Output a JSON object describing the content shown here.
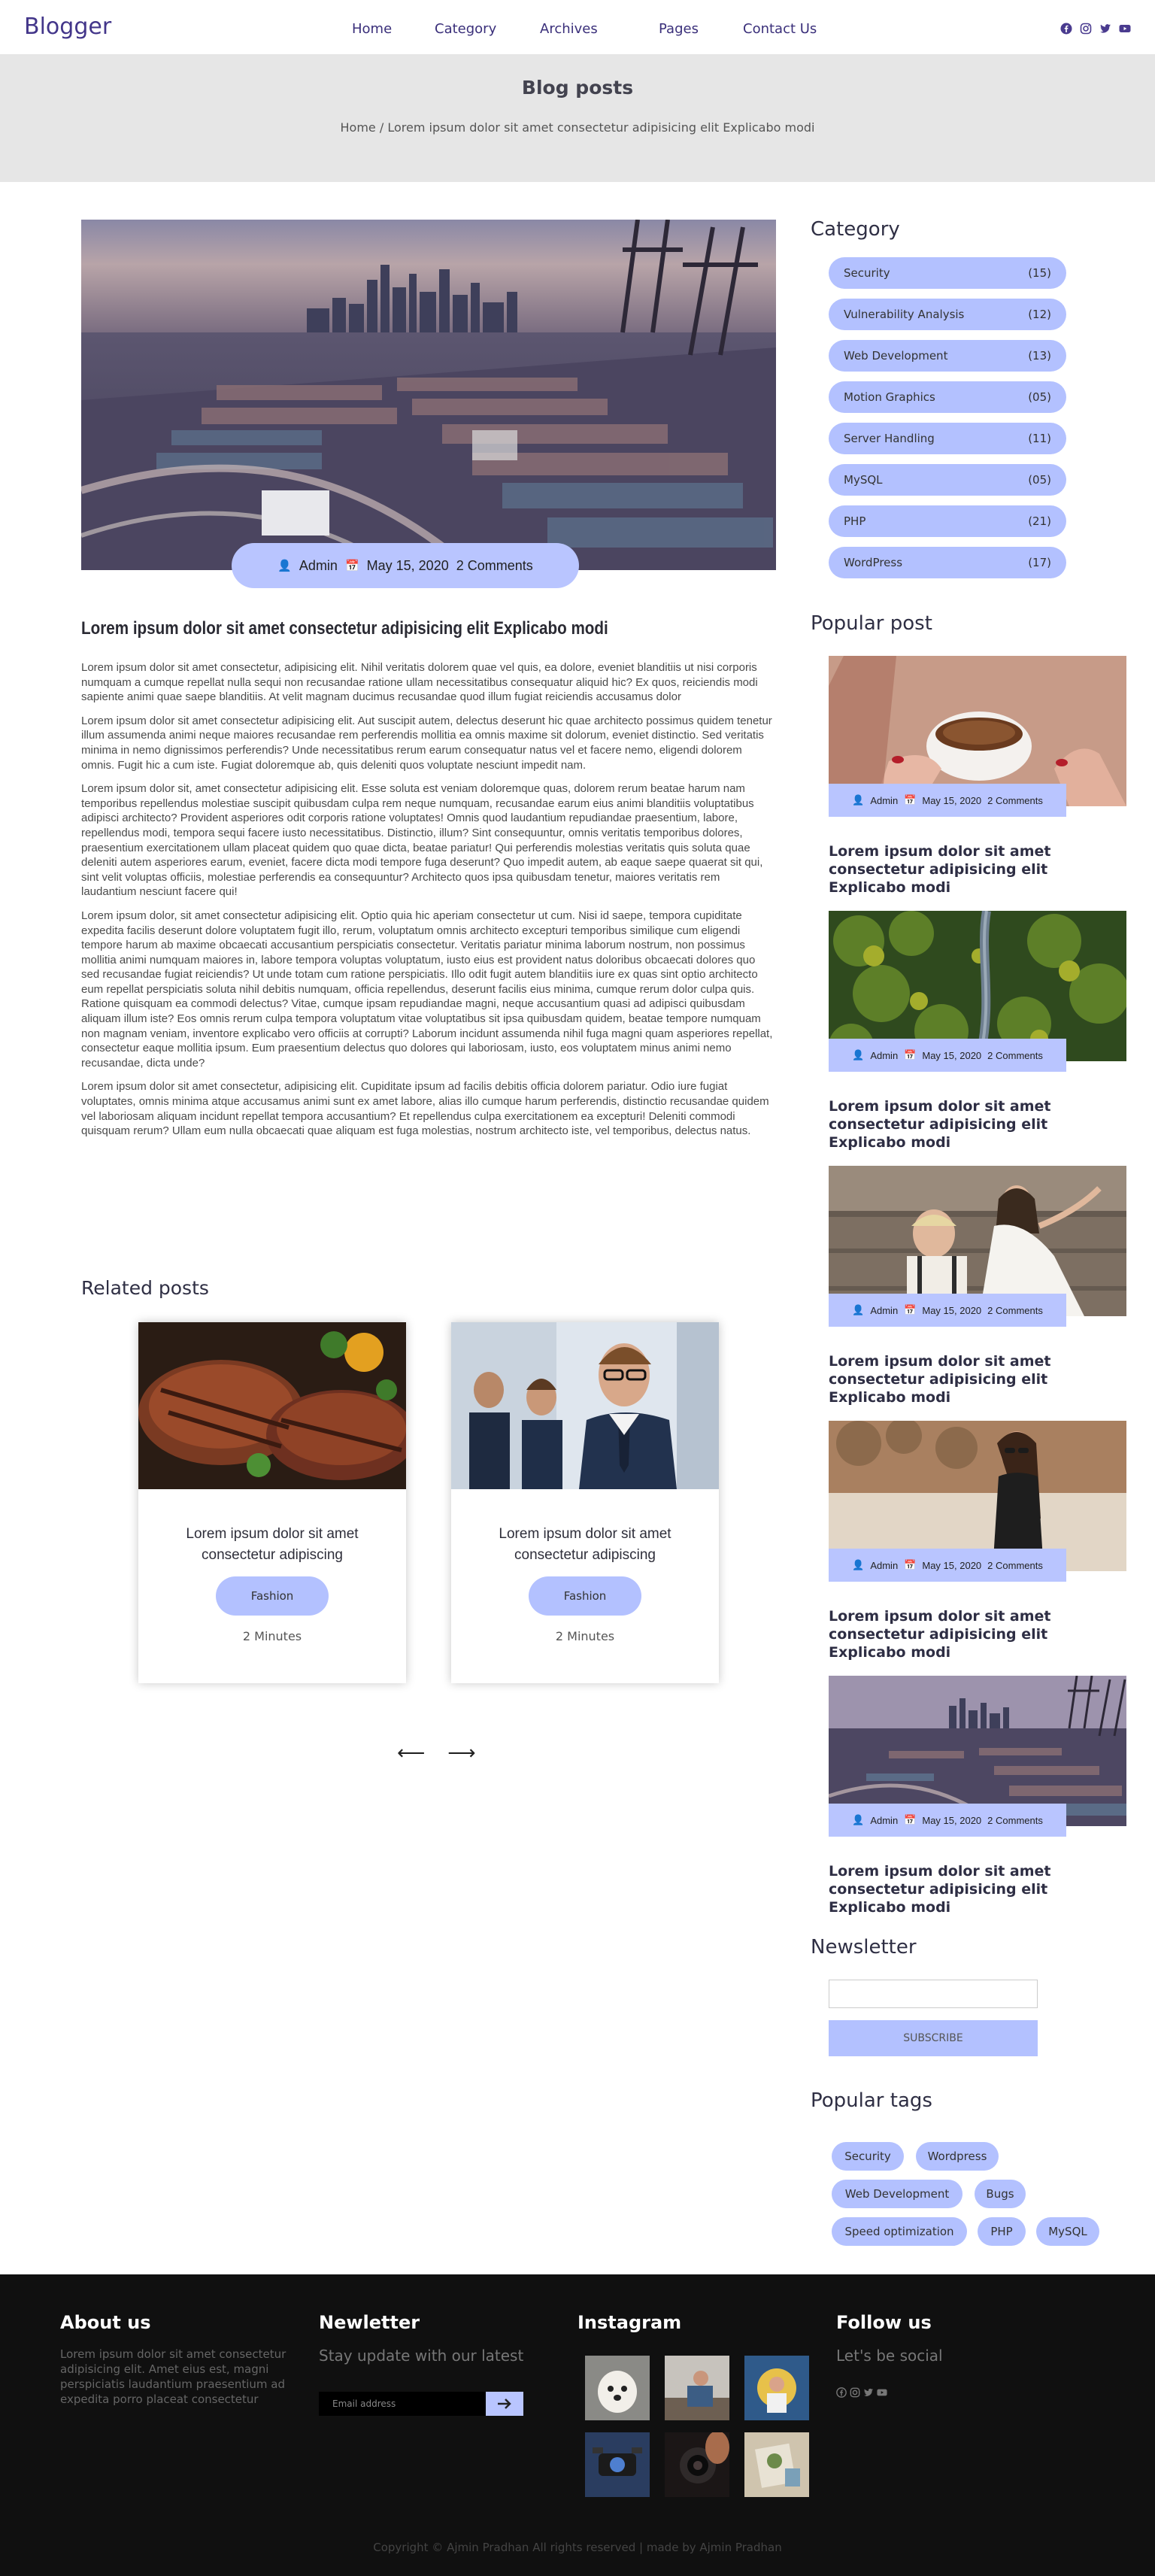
{
  "brand": "Blogger",
  "nav": {
    "items": [
      "Home",
      "Category",
      "Archives",
      "Pages",
      "Contact Us"
    ],
    "social_icons": [
      "facebook-icon",
      "instagram-icon",
      "twitter-icon",
      "youtube-icon"
    ]
  },
  "hero": {
    "title": "Blog posts",
    "breadcrumb": "Home / Lorem ipsum dolor sit amet consectetur adipisicing elit Explicabo modi"
  },
  "post": {
    "meta": {
      "author": "Admin",
      "date": "May 15, 2020",
      "comments": "2 Comments"
    },
    "title": "Lorem ipsum dolor sit amet consectetur adipisicing elit Explicabo modi",
    "paragraphs": [
      "Lorem ipsum dolor sit amet consectetur, adipisicing elit. Nihil veritatis dolorem quae vel quis, ea dolore, eveniet blanditiis ut nisi corporis numquam a cumque repellat nulla sequi non recusandae ratione ullam necessitatibus consequatur aliquid hic? Ex quos, reiciendis modi sapiente animi quae saepe blanditiis. At velit magnam ducimus recusandae quod illum fugiat reiciendis accusamus dolor",
      "Lorem ipsum dolor sit amet consectetur adipisicing elit. Aut suscipit autem, delectus deserunt hic quae architecto possimus quidem tenetur illum assumenda animi neque maiores recusandae rem perferendis mollitia ea omnis maxime sit dolorum, eveniet distinctio. Sed veritatis minima in nemo dignissimos perferendis? Unde necessitatibus rerum earum consequatur natus vel et facere nemo, eligendi dolorem omnis. Fugit hic a cum iste. Fugiat doloremque ab, quis deleniti quos voluptate nesciunt impedit nam.",
      "Lorem ipsum dolor sit, amet consectetur adipisicing elit. Esse soluta est veniam doloremque quas, dolorem rerum beatae harum nam temporibus repellendus molestiae suscipit quibusdam culpa rem neque numquam, recusandae earum eius animi blanditiis voluptatibus adipisci architecto? Provident asperiores odit corporis ratione voluptates! Omnis quod laudantium repudiandae praesentium, labore, repellendus modi, tempora sequi facere iusto necessitatibus. Distinctio, illum? Sint consequuntur, omnis veritatis temporibus dolores, praesentium exercitationem ullam placeat quidem quo quae dicta, beatae pariatur! Qui perferendis molestias veritatis quis soluta quae deleniti autem asperiores earum, eveniet, facere dicta modi tempore fuga deserunt? Quo impedit autem, ab eaque saepe quaerat sit qui, sint velit voluptas officiis, molestiae perferendis ea consequuntur? Architecto quos ipsa quibusdam tenetur, maiores veritatis rem laudantium nesciunt facere qui!",
      "Lorem ipsum dolor, sit amet consectetur adipisicing elit. Optio quia hic aperiam consectetur ut cum. Nisi id saepe, tempora cupiditate expedita facilis deserunt dolore voluptatem fugit illo, rerum, voluptatum omnis architecto excepturi temporibus similique cum eligendi tempore harum ab maxime obcaecati accusantium perspiciatis consectetur. Veritatis pariatur minima laborum nostrum, non possimus mollitia animi numquam maiores in, labore tempora voluptas voluptatum, iusto eius est provident natus doloribus obcaecati dolores quo sed recusandae fugiat reiciendis? Ut unde totam cum ratione perspiciatis. Illo odit fugit autem blanditiis iure ex quas sint optio architecto eum repellat perspiciatis soluta nihil debitis numquam, officia repellendus, deserunt facilis eius minima, cumque rerum dolor culpa quis. Ratione quisquam ea commodi delectus? Vitae, cumque ipsam repudiandae magni, neque accusantium quasi ad adipisci quibusdam aliquam illum iste? Eos omnis rerum culpa tempora voluptatum vitae voluptatibus sit ipsa quibusdam quidem, beatae tempore numquam non magnam veniam, inventore explicabo vero officiis at corrupti? Laborum incidunt assumenda nihil fuga magni quam asperiores repellat, consectetur eaque mollitia ipsum. Eum praesentium delectus quo dolores qui laboriosam, iusto, eos voluptatem minus animi nemo recusandae, dicta unde?",
      "Lorem ipsum dolor sit amet consectetur, adipisicing elit. Cupiditate ipsum ad facilis debitis officia dolorem pariatur. Odio iure fugiat voluptates, omnis minima atque accusamus animi sunt ex amet labore, alias illo cumque harum perferendis, distinctio recusandae quidem vel laboriosam aliquam incidunt repellat tempora accusantium? Et repellendus culpa exercitationem ea excepturi! Deleniti commodi quisquam rerum? Ullam eum nulla obcaecati quae aliquam est fuga molestias, nostrum architecto iste, vel temporibus, delectus natus."
    ]
  },
  "related": {
    "heading": "Related posts",
    "cards": [
      {
        "title": "Lorem ipsum dolor sit amet consectetur adipiscing",
        "tag": "Fashion",
        "time": "2 Minutes"
      },
      {
        "title": "Lorem ipsum dolor sit amet consectetur adipiscing",
        "tag": "Fashion",
        "time": "2 Minutes"
      }
    ],
    "arrows": [
      "⟵",
      "⟶"
    ]
  },
  "sidebar": {
    "category_heading": "Category",
    "categories": [
      {
        "label": "Security",
        "count": "(15)"
      },
      {
        "label": "Vulnerability Analysis",
        "count": "(12)"
      },
      {
        "label": "Web Development",
        "count": "(13)"
      },
      {
        "label": "Motion Graphics",
        "count": "(05)"
      },
      {
        "label": "Server Handling",
        "count": "(11)"
      },
      {
        "label": "MySQL",
        "count": "(05)"
      },
      {
        "label": "PHP",
        "count": "(21)"
      },
      {
        "label": "WordPress",
        "count": "(17)"
      }
    ],
    "popular_heading": "Popular post",
    "popular": [
      {
        "author": "Admin",
        "date": "May 15, 2020",
        "comments": "2 Comments",
        "title": "Lorem ipsum dolor sit amet consectetur adipisicing elit Explicabo modi"
      },
      {
        "author": "Admin",
        "date": "May 15, 2020",
        "comments": "2 Comments",
        "title": "Lorem ipsum dolor sit amet consectetur adipisicing elit Explicabo modi"
      },
      {
        "author": "Admin",
        "date": "May 15, 2020",
        "comments": "2 Comments",
        "title": "Lorem ipsum dolor sit amet consectetur adipisicing elit Explicabo modi"
      },
      {
        "author": "Admin",
        "date": "May 15, 2020",
        "comments": "2 Comments",
        "title": "Lorem ipsum dolor sit amet consectetur adipisicing elit Explicabo modi"
      },
      {
        "author": "Admin",
        "date": "May 15, 2020",
        "comments": "2 Comments",
        "title": "Lorem ipsum dolor sit amet consectetur adipisicing elit Explicabo modi"
      }
    ],
    "newsletter_heading": "Newsletter",
    "subscribe_label": "SUBSCRIBE",
    "tags_heading": "Popular tags",
    "tags": [
      "Security",
      "Wordpress",
      "Web Development",
      "Bugs",
      "Speed optimization",
      "PHP",
      "MySQL"
    ]
  },
  "footer": {
    "about_heading": "About us",
    "about_text": "Lorem ipsum dolor sit amet consectetur adipisicing elit. Amet eius est, magni perspiciatis laudantium praesentium ad expedita porro placeat consectetur",
    "newsletter_heading": "Newletter",
    "newsletter_sub": "Stay update with our latest",
    "email_placeholder": "Email address",
    "instagram_heading": "Instagram",
    "follow_heading": "Follow us",
    "follow_sub": "Let's be social",
    "copyright": "Copyright © Ajmin Pradhan All rights reserved | made by Ajmin Pradhan"
  },
  "colors": {
    "accent": "#b3c1ff",
    "brand": "#43368a",
    "footer_bg": "#101010"
  }
}
